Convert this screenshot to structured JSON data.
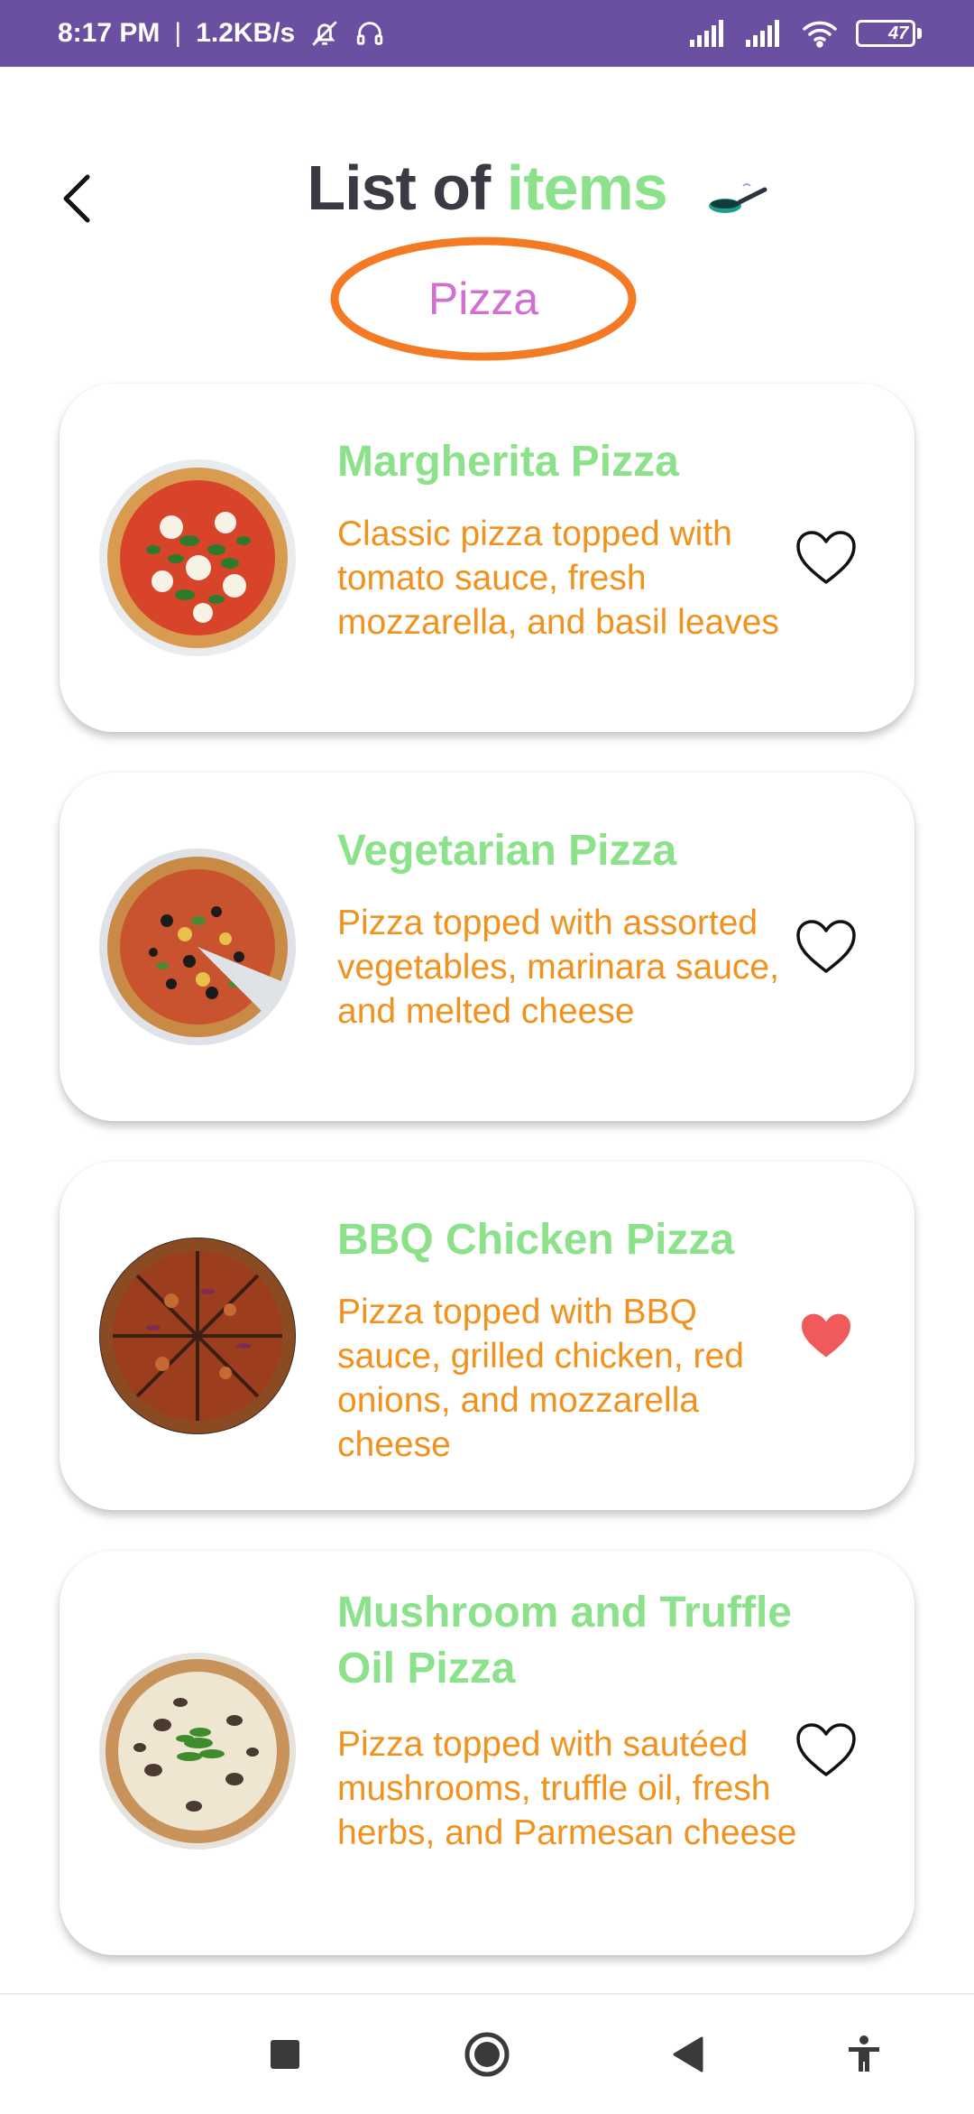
{
  "status_bar": {
    "time": "8:17 PM",
    "separator": "|",
    "speed": "1.2KB/s",
    "battery_level": "47",
    "icons": [
      "bell-off-icon",
      "headphones-icon",
      "signal-icon",
      "signal-icon",
      "wifi-icon",
      "battery-icon"
    ]
  },
  "header": {
    "title_part1": "List of",
    "title_part2": "items",
    "category": "Pizza",
    "colors": {
      "title_dark": "#3a3a44",
      "title_green": "#8be28b",
      "category": "#d26fd0",
      "category_ring": "#f47a24"
    }
  },
  "items": [
    {
      "name": "Margherita Pizza",
      "description": "Classic pizza topped with tomato sauce, fresh mozzarella, and basil leaves",
      "favorite": false
    },
    {
      "name": "Vegetarian Pizza",
      "description": "Pizza topped with assorted vegetables, marinara sauce, and melted cheese",
      "favorite": false
    },
    {
      "name": "BBQ Chicken Pizza",
      "description": "Pizza topped with BBQ sauce, grilled chicken, red onions, and mozzarella cheese",
      "favorite": true
    },
    {
      "name": "Mushroom and Truffle Oil Pizza",
      "description": "Pizza topped with sautéed mushrooms, truffle oil, fresh herbs, and Parmesan cheese",
      "favorite": false
    }
  ],
  "colors": {
    "status_bar": "#6b4fa0",
    "item_name": "#8be28b",
    "item_desc": "#f2921e",
    "favorite_active": "#f05a5a"
  },
  "nav_bar": {
    "icons": [
      "recents-square-icon",
      "home-circle-icon",
      "back-triangle-icon",
      "accessibility-icon"
    ]
  }
}
